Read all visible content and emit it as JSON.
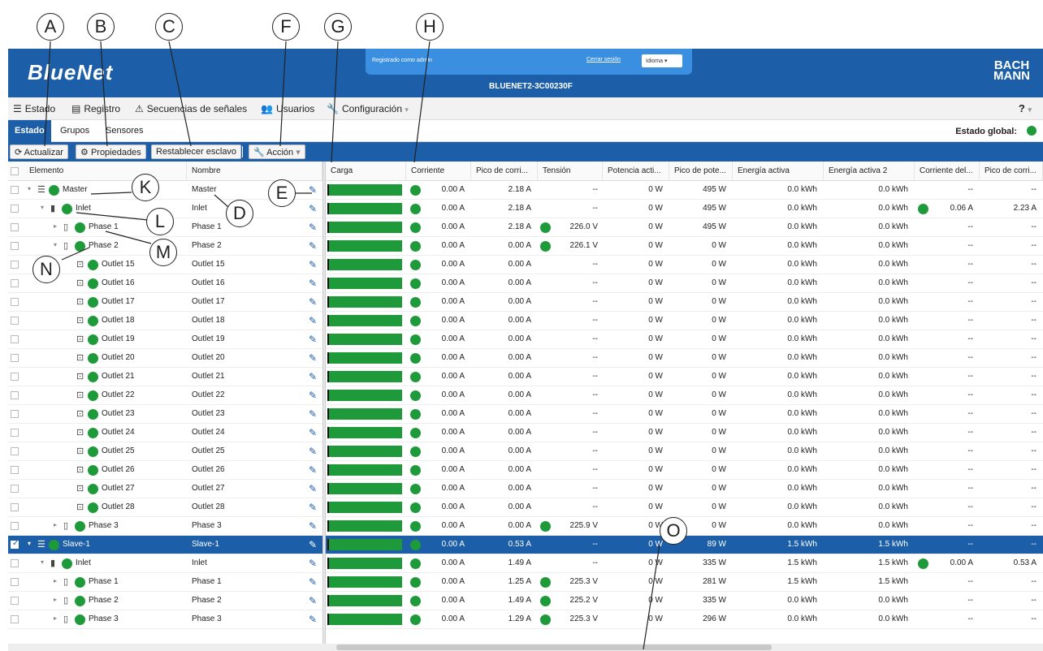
{
  "callouts": [
    "A",
    "B",
    "C",
    "F",
    "G",
    "H",
    "K",
    "D",
    "E",
    "L",
    "M",
    "N",
    "O"
  ],
  "header": {
    "logo": "BlueNet",
    "login_text": "Registrado como admin",
    "logout": "Cerrar sesión",
    "language": "Idioma",
    "device": "BLUENET2-3C00230F",
    "brand_line1": "BACH",
    "brand_line2": "MANN"
  },
  "menu": [
    "Estado",
    "Registro",
    "Secuencias de señales",
    "Usuarios",
    "Configuración"
  ],
  "menu_icons": [
    "layers-icon",
    "list-icon",
    "warning-icon",
    "users-icon",
    "wrench-icon"
  ],
  "tabs": [
    "Estado",
    "Grupos",
    "Sensores"
  ],
  "global_status": "Estado global:",
  "toolbar": {
    "refresh": "Actualizar",
    "properties": "Propiedades",
    "reset_slave": "Restablecer esclavo",
    "action": "Acción"
  },
  "columns": [
    "Elemento",
    "Nombre",
    "Carga",
    "Corriente",
    "Pico de corri...",
    "Tensión",
    "Potencia acti...",
    "Pico de pote...",
    "Energía activa",
    "Energía activa 2",
    "Corriente del...",
    "Pico de corri..."
  ],
  "rows": [
    {
      "level": 0,
      "icon": "stack-icon",
      "caret": "▾",
      "el": "Master",
      "name": "Master",
      "cur": "0.00 A",
      "peak": "2.18 A",
      "tdot": false,
      "volt": "--",
      "pw": "0 W",
      "pp": "495 W",
      "e1": "0.0 kWh",
      "e2": "0.0 kWh",
      "rdot": false,
      "rc": "--",
      "rp": "--",
      "sel": false,
      "chk": false
    },
    {
      "level": 1,
      "icon": "inlet-icon",
      "caret": "▾",
      "el": "Inlet",
      "name": "Inlet",
      "cur": "0.00 A",
      "peak": "2.18 A",
      "tdot": false,
      "volt": "--",
      "pw": "0 W",
      "pp": "495 W",
      "e1": "0.0 kWh",
      "e2": "0.0 kWh",
      "rdot": true,
      "rc": "0.06 A",
      "rp": "2.23 A",
      "sel": false,
      "chk": false
    },
    {
      "level": 2,
      "icon": "phase-icon",
      "caret": "▸",
      "el": "Phase 1",
      "name": "Phase 1",
      "cur": "0.00 A",
      "peak": "2.18 A",
      "tdot": true,
      "volt": "226.0 V",
      "pw": "0 W",
      "pp": "495 W",
      "e1": "0.0 kWh",
      "e2": "0.0 kWh",
      "rdot": false,
      "rc": "--",
      "rp": "--",
      "sel": false,
      "chk": false
    },
    {
      "level": 2,
      "icon": "phase-icon",
      "caret": "▾",
      "el": "Phase 2",
      "name": "Phase 2",
      "cur": "0.00 A",
      "peak": "0.00 A",
      "tdot": true,
      "volt": "226.1 V",
      "pw": "0 W",
      "pp": "0 W",
      "e1": "0.0 kWh",
      "e2": "0.0 kWh",
      "rdot": false,
      "rc": "--",
      "rp": "--",
      "sel": false,
      "chk": false
    },
    {
      "level": 3,
      "icon": "outlet-icon",
      "caret": "",
      "el": "Outlet 15",
      "name": "Outlet 15",
      "cur": "0.00 A",
      "peak": "0.00 A",
      "tdot": false,
      "volt": "--",
      "pw": "0 W",
      "pp": "0 W",
      "e1": "0.0 kWh",
      "e2": "0.0 kWh",
      "rdot": false,
      "rc": "--",
      "rp": "--",
      "sel": false,
      "chk": false
    },
    {
      "level": 3,
      "icon": "outlet-icon",
      "caret": "",
      "el": "Outlet 16",
      "name": "Outlet 16",
      "cur": "0.00 A",
      "peak": "0.00 A",
      "tdot": false,
      "volt": "--",
      "pw": "0 W",
      "pp": "0 W",
      "e1": "0.0 kWh",
      "e2": "0.0 kWh",
      "rdot": false,
      "rc": "--",
      "rp": "--",
      "sel": false,
      "chk": false
    },
    {
      "level": 3,
      "icon": "outlet-icon",
      "caret": "",
      "el": "Outlet 17",
      "name": "Outlet 17",
      "cur": "0.00 A",
      "peak": "0.00 A",
      "tdot": false,
      "volt": "--",
      "pw": "0 W",
      "pp": "0 W",
      "e1": "0.0 kWh",
      "e2": "0.0 kWh",
      "rdot": false,
      "rc": "--",
      "rp": "--",
      "sel": false,
      "chk": false
    },
    {
      "level": 3,
      "icon": "outlet-icon",
      "caret": "",
      "el": "Outlet 18",
      "name": "Outlet 18",
      "cur": "0.00 A",
      "peak": "0.00 A",
      "tdot": false,
      "volt": "--",
      "pw": "0 W",
      "pp": "0 W",
      "e1": "0.0 kWh",
      "e2": "0.0 kWh",
      "rdot": false,
      "rc": "--",
      "rp": "--",
      "sel": false,
      "chk": false
    },
    {
      "level": 3,
      "icon": "outlet-icon",
      "caret": "",
      "el": "Outlet 19",
      "name": "Outlet 19",
      "cur": "0.00 A",
      "peak": "0.00 A",
      "tdot": false,
      "volt": "--",
      "pw": "0 W",
      "pp": "0 W",
      "e1": "0.0 kWh",
      "e2": "0.0 kWh",
      "rdot": false,
      "rc": "--",
      "rp": "--",
      "sel": false,
      "chk": false
    },
    {
      "level": 3,
      "icon": "outlet-icon",
      "caret": "",
      "el": "Outlet 20",
      "name": "Outlet 20",
      "cur": "0.00 A",
      "peak": "0.00 A",
      "tdot": false,
      "volt": "--",
      "pw": "0 W",
      "pp": "0 W",
      "e1": "0.0 kWh",
      "e2": "0.0 kWh",
      "rdot": false,
      "rc": "--",
      "rp": "--",
      "sel": false,
      "chk": false
    },
    {
      "level": 3,
      "icon": "outlet-icon",
      "caret": "",
      "el": "Outlet 21",
      "name": "Outlet 21",
      "cur": "0.00 A",
      "peak": "0.00 A",
      "tdot": false,
      "volt": "--",
      "pw": "0 W",
      "pp": "0 W",
      "e1": "0.0 kWh",
      "e2": "0.0 kWh",
      "rdot": false,
      "rc": "--",
      "rp": "--",
      "sel": false,
      "chk": false
    },
    {
      "level": 3,
      "icon": "outlet-icon",
      "caret": "",
      "el": "Outlet 22",
      "name": "Outlet 22",
      "cur": "0.00 A",
      "peak": "0.00 A",
      "tdot": false,
      "volt": "--",
      "pw": "0 W",
      "pp": "0 W",
      "e1": "0.0 kWh",
      "e2": "0.0 kWh",
      "rdot": false,
      "rc": "--",
      "rp": "--",
      "sel": false,
      "chk": false
    },
    {
      "level": 3,
      "icon": "outlet-icon",
      "caret": "",
      "el": "Outlet 23",
      "name": "Outlet 23",
      "cur": "0.00 A",
      "peak": "0.00 A",
      "tdot": false,
      "volt": "--",
      "pw": "0 W",
      "pp": "0 W",
      "e1": "0.0 kWh",
      "e2": "0.0 kWh",
      "rdot": false,
      "rc": "--",
      "rp": "--",
      "sel": false,
      "chk": false
    },
    {
      "level": 3,
      "icon": "outlet-icon",
      "caret": "",
      "el": "Outlet 24",
      "name": "Outlet 24",
      "cur": "0.00 A",
      "peak": "0.00 A",
      "tdot": false,
      "volt": "--",
      "pw": "0 W",
      "pp": "0 W",
      "e1": "0.0 kWh",
      "e2": "0.0 kWh",
      "rdot": false,
      "rc": "--",
      "rp": "--",
      "sel": false,
      "chk": false
    },
    {
      "level": 3,
      "icon": "outlet-icon",
      "caret": "",
      "el": "Outlet 25",
      "name": "Outlet 25",
      "cur": "0.00 A",
      "peak": "0.00 A",
      "tdot": false,
      "volt": "--",
      "pw": "0 W",
      "pp": "0 W",
      "e1": "0.0 kWh",
      "e2": "0.0 kWh",
      "rdot": false,
      "rc": "--",
      "rp": "--",
      "sel": false,
      "chk": false
    },
    {
      "level": 3,
      "icon": "outlet-icon",
      "caret": "",
      "el": "Outlet 26",
      "name": "Outlet 26",
      "cur": "0.00 A",
      "peak": "0.00 A",
      "tdot": false,
      "volt": "--",
      "pw": "0 W",
      "pp": "0 W",
      "e1": "0.0 kWh",
      "e2": "0.0 kWh",
      "rdot": false,
      "rc": "--",
      "rp": "--",
      "sel": false,
      "chk": false
    },
    {
      "level": 3,
      "icon": "outlet-icon",
      "caret": "",
      "el": "Outlet 27",
      "name": "Outlet 27",
      "cur": "0.00 A",
      "peak": "0.00 A",
      "tdot": false,
      "volt": "--",
      "pw": "0 W",
      "pp": "0 W",
      "e1": "0.0 kWh",
      "e2": "0.0 kWh",
      "rdot": false,
      "rc": "--",
      "rp": "--",
      "sel": false,
      "chk": false
    },
    {
      "level": 3,
      "icon": "outlet-icon",
      "caret": "",
      "el": "Outlet 28",
      "name": "Outlet 28",
      "cur": "0.00 A",
      "peak": "0.00 A",
      "tdot": false,
      "volt": "--",
      "pw": "0 W",
      "pp": "0 W",
      "e1": "0.0 kWh",
      "e2": "0.0 kWh",
      "rdot": false,
      "rc": "--",
      "rp": "--",
      "sel": false,
      "chk": false
    },
    {
      "level": 2,
      "icon": "phase-icon",
      "caret": "▸",
      "el": "Phase 3",
      "name": "Phase 3",
      "cur": "0.00 A",
      "peak": "0.00 A",
      "tdot": true,
      "volt": "225.9 V",
      "pw": "0 W",
      "pp": "0 W",
      "e1": "0.0 kWh",
      "e2": "0.0 kWh",
      "rdot": false,
      "rc": "--",
      "rp": "--",
      "sel": false,
      "chk": false
    },
    {
      "level": 0,
      "icon": "stack-icon",
      "caret": "▾",
      "el": "Slave-1",
      "name": "Slave-1",
      "cur": "0.00 A",
      "peak": "0.53 A",
      "tdot": false,
      "volt": "--",
      "pw": "0 W",
      "pp": "89 W",
      "e1": "1.5 kWh",
      "e2": "1.5 kWh",
      "rdot": false,
      "rc": "--",
      "rp": "--",
      "sel": true,
      "chk": true
    },
    {
      "level": 1,
      "icon": "inlet-icon",
      "caret": "▾",
      "el": "Inlet",
      "name": "Inlet",
      "cur": "0.00 A",
      "peak": "1.49 A",
      "tdot": false,
      "volt": "--",
      "pw": "0 W",
      "pp": "335 W",
      "e1": "1.5 kWh",
      "e2": "1.5 kWh",
      "rdot": true,
      "rc": "0.00 A",
      "rp": "0.53 A",
      "sel": false,
      "chk": false
    },
    {
      "level": 2,
      "icon": "phase-icon",
      "caret": "▸",
      "el": "Phase 1",
      "name": "Phase 1",
      "cur": "0.00 A",
      "peak": "1.25 A",
      "tdot": true,
      "volt": "225.3 V",
      "pw": "0 W",
      "pp": "281 W",
      "e1": "1.5 kWh",
      "e2": "1.5 kWh",
      "rdot": false,
      "rc": "--",
      "rp": "--",
      "sel": false,
      "chk": false
    },
    {
      "level": 2,
      "icon": "phase-icon",
      "caret": "▸",
      "el": "Phase 2",
      "name": "Phase 2",
      "cur": "0.00 A",
      "peak": "1.49 A",
      "tdot": true,
      "volt": "225.2 V",
      "pw": "0 W",
      "pp": "335 W",
      "e1": "0.0 kWh",
      "e2": "0.0 kWh",
      "rdot": false,
      "rc": "--",
      "rp": "--",
      "sel": false,
      "chk": false
    },
    {
      "level": 2,
      "icon": "phase-icon",
      "caret": "▸",
      "el": "Phase 3",
      "name": "Phase 3",
      "cur": "0.00 A",
      "peak": "1.29 A",
      "tdot": true,
      "volt": "225.3 V",
      "pw": "0 W",
      "pp": "296 W",
      "e1": "0.0 kWh",
      "e2": "0.0 kWh",
      "rdot": false,
      "rc": "--",
      "rp": "--",
      "sel": false,
      "chk": false
    }
  ],
  "load_fill": 1.0,
  "colors": {
    "brand_blue": "#1c5fa8",
    "status_green": "#1f9a3b"
  }
}
